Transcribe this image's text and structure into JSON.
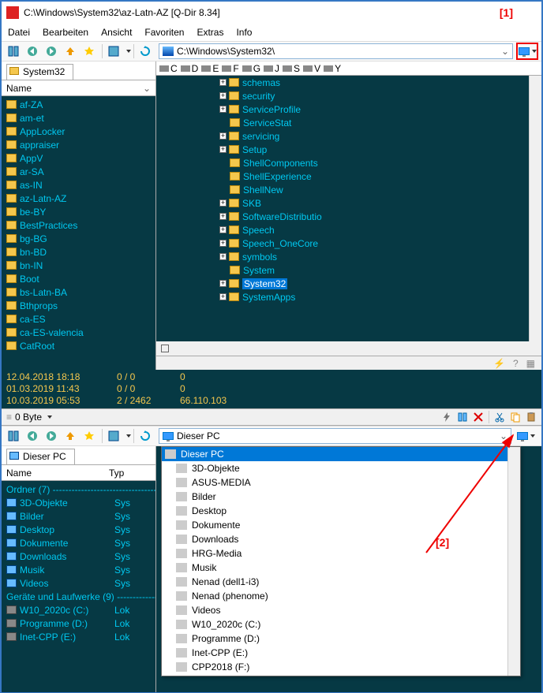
{
  "title": "C:\\Windows\\System32\\az-Latn-AZ  [Q-Dir 8.34]",
  "annotations": {
    "a1": "[1]",
    "a2": "[2]"
  },
  "menu": [
    "Datei",
    "Bearbeiten",
    "Ansicht",
    "Favoriten",
    "Extras",
    "Info"
  ],
  "addr_top": "C:\\Windows\\System32\\",
  "tab_top_left": "System32",
  "col_name": "Name",
  "drives_top": [
    "C",
    "D",
    "E",
    "F",
    "G",
    "J",
    "S",
    "V",
    "Y"
  ],
  "left_folders": [
    "af-ZA",
    "am-et",
    "AppLocker",
    "appraiser",
    "AppV",
    "ar-SA",
    "as-IN",
    "az-Latn-AZ",
    "be-BY",
    "BestPractices",
    "bg-BG",
    "bn-BD",
    "bn-IN",
    "Boot",
    "bs-Latn-BA",
    "Bthprops",
    "ca-ES",
    "ca-ES-valencia",
    "CatRoot"
  ],
  "tree_items": [
    {
      "label": "schemas",
      "exp": "+"
    },
    {
      "label": "security",
      "exp": "+"
    },
    {
      "label": "ServiceProfile",
      "exp": "+"
    },
    {
      "label": "ServiceStat",
      "exp": ""
    },
    {
      "label": "servicing",
      "exp": "+"
    },
    {
      "label": "Setup",
      "exp": "+"
    },
    {
      "label": "ShellComponents",
      "exp": ""
    },
    {
      "label": "ShellExperience",
      "exp": ""
    },
    {
      "label": "ShellNew",
      "exp": ""
    },
    {
      "label": "SKB",
      "exp": "+"
    },
    {
      "label": "SoftwareDistributio",
      "exp": "+"
    },
    {
      "label": "Speech",
      "exp": "+"
    },
    {
      "label": "Speech_OneCore",
      "exp": "+"
    },
    {
      "label": "symbols",
      "exp": "+"
    },
    {
      "label": "System",
      "exp": ""
    },
    {
      "label": "System32",
      "exp": "+",
      "sel": true
    },
    {
      "label": "SystemApps",
      "exp": "+"
    }
  ],
  "status_rows": [
    {
      "c1": "12.04.2018 18:18",
      "c2": "0 / 0",
      "c3": "0"
    },
    {
      "c1": "01.03.2019 11:43",
      "c2": "0 / 0",
      "c3": "0"
    },
    {
      "c1": "10.03.2019 05:53",
      "c2": "2 / 2462",
      "c3": "66.110.103"
    }
  ],
  "split_label": "0 Byte",
  "addr_bottom": "Dieser PC",
  "tab_bottom_left": "Dieser PC",
  "col_type": "Typ",
  "bottom_groups": {
    "g1": "Ordner (7)",
    "g2": "Geräte und Laufwerke (9)"
  },
  "bottom_left_items": [
    {
      "label": "3D-Objekte",
      "type": "Sys"
    },
    {
      "label": "Bilder",
      "type": "Sys"
    },
    {
      "label": "Desktop",
      "type": "Sys"
    },
    {
      "label": "Dokumente",
      "type": "Sys"
    },
    {
      "label": "Downloads",
      "type": "Sys"
    },
    {
      "label": "Musik",
      "type": "Sys"
    },
    {
      "label": "Videos",
      "type": "Sys"
    }
  ],
  "bottom_left_drives": [
    {
      "label": "W10_2020c (C:)",
      "type": "Lok"
    },
    {
      "label": "Programme (D:)",
      "type": "Lok"
    },
    {
      "label": "Inet-CPP (E:)",
      "type": "Lok"
    }
  ],
  "dropdown_items": [
    {
      "label": "Dieser PC",
      "sel": true,
      "indent": 0
    },
    {
      "label": "3D-Objekte",
      "indent": 1
    },
    {
      "label": "ASUS-MEDIA",
      "indent": 1
    },
    {
      "label": "Bilder",
      "indent": 1
    },
    {
      "label": "Desktop",
      "indent": 1
    },
    {
      "label": "Dokumente",
      "indent": 1
    },
    {
      "label": "Downloads",
      "indent": 1
    },
    {
      "label": "HRG-Media",
      "indent": 1
    },
    {
      "label": "Musik",
      "indent": 1
    },
    {
      "label": "Nenad (dell1-i3)",
      "indent": 1
    },
    {
      "label": "Nenad (phenome)",
      "indent": 1
    },
    {
      "label": "Videos",
      "indent": 1
    },
    {
      "label": "W10_2020c (C:)",
      "indent": 1
    },
    {
      "label": "Programme (D:)",
      "indent": 1
    },
    {
      "label": "Inet-CPP (E:)",
      "indent": 1
    },
    {
      "label": "CPP2018 (F:)",
      "indent": 1
    }
  ],
  "dashes": "---------------------------------"
}
